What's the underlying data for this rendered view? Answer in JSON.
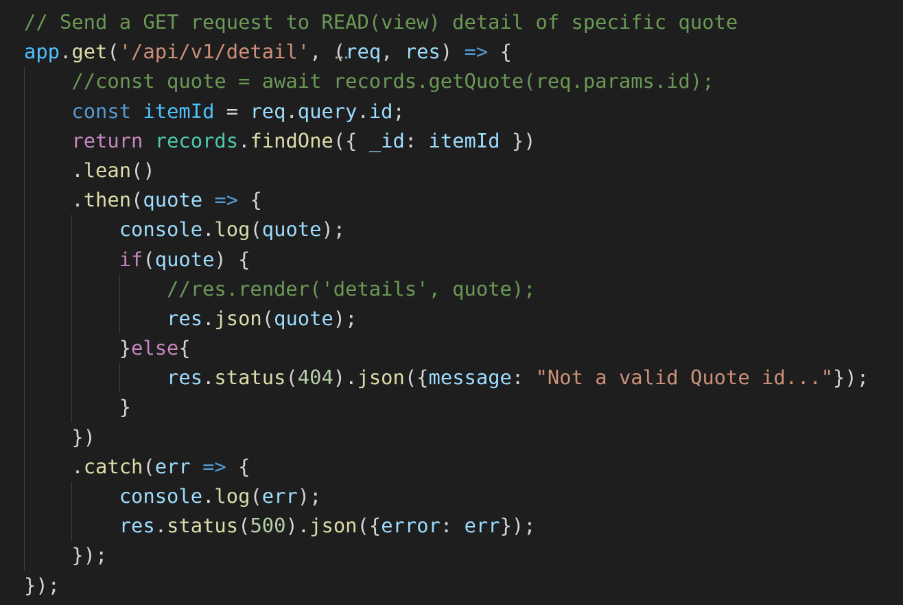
{
  "editor": {
    "lines": [
      [
        [
          "// Send a GET request to READ(view) detail of specific quote",
          "c"
        ]
      ],
      [
        [
          "app",
          "cn"
        ],
        [
          ".",
          "p"
        ],
        [
          "get",
          "f"
        ],
        [
          "(",
          "p"
        ],
        [
          "'/api/v1/detail'",
          "s"
        ],
        [
          ", (",
          "p"
        ],
        [
          "req",
          "v"
        ],
        [
          ", ",
          "p"
        ],
        [
          "res",
          "v"
        ],
        [
          ") ",
          "p"
        ],
        [
          "=>",
          "k"
        ],
        [
          " {",
          "p"
        ]
      ],
      [
        [
          "    ",
          "p"
        ],
        [
          "//const quote = await records.getQuote(req.params.id);",
          "c"
        ]
      ],
      [
        [
          "    ",
          "p"
        ],
        [
          "const",
          "k"
        ],
        [
          " ",
          "p"
        ],
        [
          "itemId",
          "cn"
        ],
        [
          " = ",
          "p"
        ],
        [
          "req",
          "v"
        ],
        [
          ".",
          "p"
        ],
        [
          "query",
          "v"
        ],
        [
          ".",
          "p"
        ],
        [
          "id",
          "v"
        ],
        [
          ";",
          "p"
        ]
      ],
      [
        [
          "    ",
          "p"
        ],
        [
          "return",
          "ctl"
        ],
        [
          " ",
          "p"
        ],
        [
          "records",
          "t"
        ],
        [
          ".",
          "p"
        ],
        [
          "findOne",
          "f"
        ],
        [
          "({ ",
          "p"
        ],
        [
          "_id",
          "v"
        ],
        [
          ": ",
          "p"
        ],
        [
          "itemId",
          "v"
        ],
        [
          " })",
          "p"
        ]
      ],
      [
        [
          "    .",
          "p"
        ],
        [
          "lean",
          "f"
        ],
        [
          "()",
          "p"
        ]
      ],
      [
        [
          "    .",
          "p"
        ],
        [
          "then",
          "f"
        ],
        [
          "(",
          "p"
        ],
        [
          "quote",
          "v"
        ],
        [
          " ",
          "p"
        ],
        [
          "=>",
          "k"
        ],
        [
          " {",
          "p"
        ]
      ],
      [
        [
          "        ",
          "p"
        ],
        [
          "console",
          "v"
        ],
        [
          ".",
          "p"
        ],
        [
          "log",
          "f"
        ],
        [
          "(",
          "p"
        ],
        [
          "quote",
          "v"
        ],
        [
          ");",
          "p"
        ]
      ],
      [
        [
          "        ",
          "p"
        ],
        [
          "if",
          "ctl"
        ],
        [
          "(",
          "p"
        ],
        [
          "quote",
          "v"
        ],
        [
          ") {",
          "p"
        ]
      ],
      [
        [
          "            ",
          "p"
        ],
        [
          "//res.render('details', quote);",
          "c"
        ]
      ],
      [
        [
          "            ",
          "p"
        ],
        [
          "res",
          "v"
        ],
        [
          ".",
          "p"
        ],
        [
          "json",
          "f"
        ],
        [
          "(",
          "p"
        ],
        [
          "quote",
          "v"
        ],
        [
          ");",
          "p"
        ]
      ],
      [
        [
          "        }",
          "p"
        ],
        [
          "else",
          "ctl"
        ],
        [
          "{",
          "p"
        ]
      ],
      [
        [
          "            ",
          "p"
        ],
        [
          "res",
          "v"
        ],
        [
          ".",
          "p"
        ],
        [
          "status",
          "f"
        ],
        [
          "(",
          "p"
        ],
        [
          "404",
          "n"
        ],
        [
          ").",
          "p"
        ],
        [
          "json",
          "f"
        ],
        [
          "({",
          "p"
        ],
        [
          "message",
          "v"
        ],
        [
          ": ",
          "p"
        ],
        [
          "\"Not a valid Quote id...\"",
          "s"
        ],
        [
          "});",
          "p"
        ]
      ],
      [
        [
          "        }",
          "p"
        ]
      ],
      [
        [
          "    })",
          "p"
        ]
      ],
      [
        [
          "    .",
          "p"
        ],
        [
          "catch",
          "f"
        ],
        [
          "(",
          "p"
        ],
        [
          "err",
          "v"
        ],
        [
          " ",
          "p"
        ],
        [
          "=>",
          "k"
        ],
        [
          " {",
          "p"
        ]
      ],
      [
        [
          "        ",
          "p"
        ],
        [
          "console",
          "v"
        ],
        [
          ".",
          "p"
        ],
        [
          "log",
          "f"
        ],
        [
          "(",
          "p"
        ],
        [
          "err",
          "v"
        ],
        [
          ");",
          "p"
        ]
      ],
      [
        [
          "        ",
          "p"
        ],
        [
          "res",
          "v"
        ],
        [
          ".",
          "p"
        ],
        [
          "status",
          "f"
        ],
        [
          "(",
          "p"
        ],
        [
          "500",
          "n"
        ],
        [
          ").",
          "p"
        ],
        [
          "json",
          "f"
        ],
        [
          "({",
          "p"
        ],
        [
          "error",
          "v"
        ],
        [
          ": ",
          "p"
        ],
        [
          "err",
          "v"
        ],
        [
          "});",
          "p"
        ]
      ],
      [
        [
          "    });",
          "p"
        ]
      ],
      [
        [
          "});",
          "p"
        ]
      ]
    ]
  }
}
